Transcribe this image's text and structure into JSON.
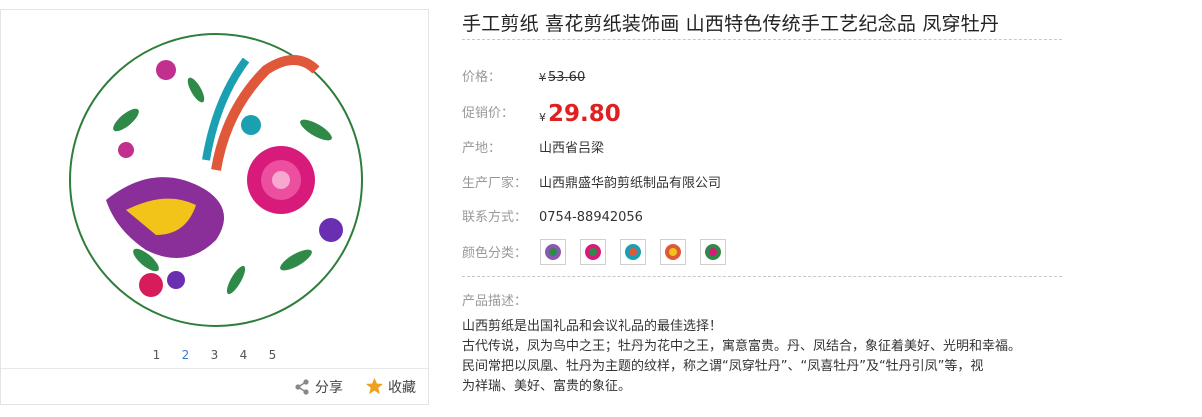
{
  "gallery": {
    "pages": [
      "1",
      "2",
      "3",
      "4",
      "5"
    ],
    "active_page": "2",
    "share_label": "分享",
    "favorite_label": "收藏"
  },
  "product": {
    "title": "手工剪纸  喜花剪纸装饰画 山西特色传统手工艺纪念品 凤穿牡丹",
    "price_label": "价格：",
    "price_currency": "¥",
    "price_value": "53.60",
    "promo_label": "促销价：",
    "promo_currency": "¥",
    "promo_value": "29.80",
    "origin_label": "产地：",
    "origin_value": "山西省吕梁",
    "maker_label": "生产厂家：",
    "maker_value": "山西鼎盛华韵剪纸制品有限公司",
    "contact_label": "联系方式：",
    "contact_value": "0754-88942056",
    "color_label": "颜色分类：",
    "desc_label": "产品描述：",
    "desc_lines": [
      "山西剪纸是出国礼品和会议礼品的最佳选择！",
      "古代传说，凤为鸟中之王；牡丹为花中之王，寓意富贵。丹、凤结合，象征着美好、光明和幸福。",
      "民间常把以凤凰、牡丹为主题的纹样，称之谓“凤穿牡丹”、“凤喜牡丹”及“牡丹引凤”等，视",
      "为祥瑞、美好、富贵的象征。"
    ]
  },
  "colors": {
    "promo": "#e02020",
    "active_page": "#3a7bd5",
    "share_icon": "#888888",
    "star_icon": "#f0a020"
  },
  "icons": {
    "share": "share-icon",
    "favorite": "star-icon"
  }
}
